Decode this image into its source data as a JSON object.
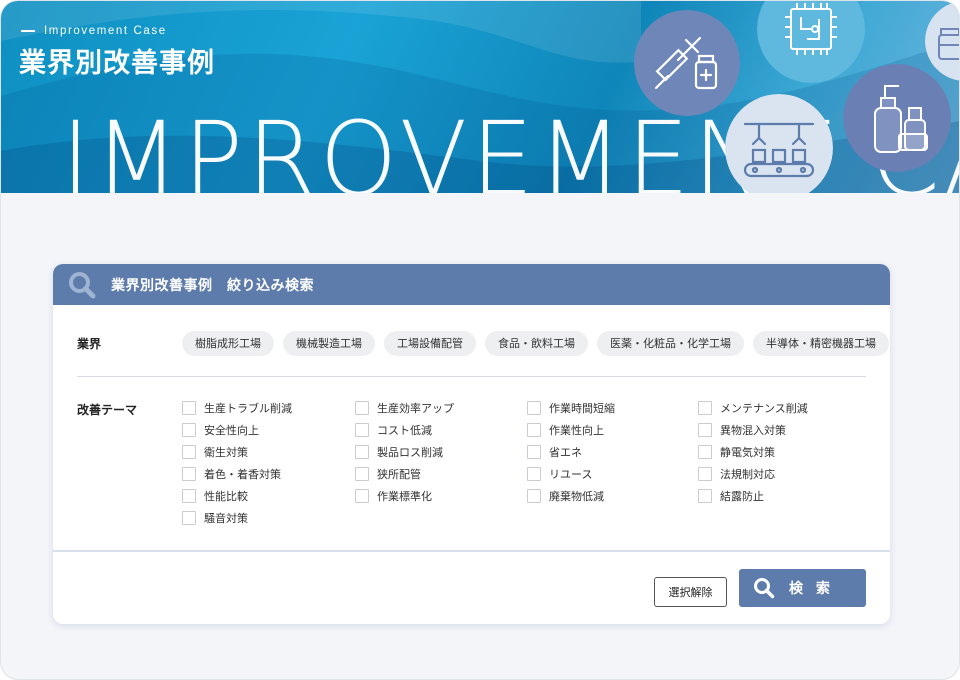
{
  "hero": {
    "eyebrow": "Improvement Case",
    "title": "業界別改善事例",
    "big_word": "IMPROVEMENT CA"
  },
  "search_card": {
    "title": "業界別改善事例　絞り込み検索",
    "industry_label": "業界",
    "industries": [
      "樹脂成形工場",
      "機械製造工場",
      "工場設備配管",
      "食品・飲料工場",
      "医薬・化粧品・化学工場",
      "半導体・精密機器工場"
    ],
    "theme_label": "改善テーマ",
    "theme_columns": [
      [
        "生産トラブル削減",
        "安全性向上",
        "衛生対策",
        "着色・着香対策",
        "性能比較",
        "騒音対策"
      ],
      [
        "生産効率アップ",
        "コスト低減",
        "製品ロス削減",
        "狭所配管",
        "作業標準化"
      ],
      [
        "作業時間短縮",
        "作業性向上",
        "省エネ",
        "リユース",
        "廃棄物低減"
      ],
      [
        "メンテナンス削減",
        "異物混入対策",
        "静電気対策",
        "法規制対応",
        "結露防止"
      ]
    ],
    "clear_button": "選択解除",
    "search_button": "検 索"
  },
  "colors": {
    "accent": "#5d7bab",
    "hero_blue": "#1aa3d6",
    "chip_bg": "#eeeff1",
    "page_bg": "#f3f5f9"
  },
  "icons": [
    "search-icon",
    "syringe-vial-icon",
    "microchip-icon",
    "bottles-icon",
    "conveyor-robot-icon",
    "jar-icon"
  ]
}
